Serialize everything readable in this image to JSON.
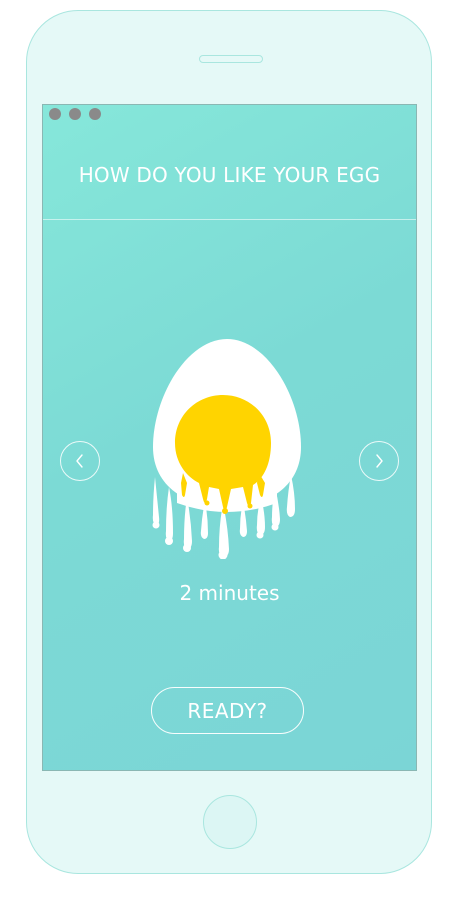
{
  "screen": {
    "title": "HOW DO YOU LIKE YOUR EGG",
    "cook_time": "2 minutes",
    "ready_label": "READY?"
  },
  "icons": {
    "prev": "chevron-left-icon",
    "next": "chevron-right-icon",
    "egg": "egg-illustration"
  },
  "colors": {
    "screen_gradient_start": "#86e7da",
    "screen_gradient_end": "#7bd5d6",
    "yolk": "#ffd400",
    "egg_white": "#ffffff",
    "window_dots": "#8a8a8a"
  }
}
